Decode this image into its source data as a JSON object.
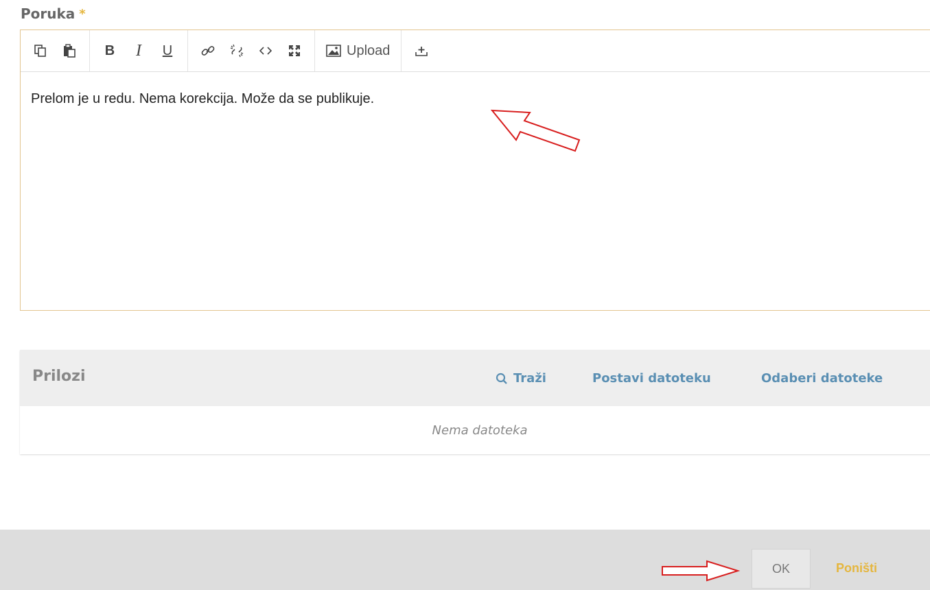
{
  "form": {
    "label": "Poruka",
    "required_mark": "*"
  },
  "toolbar": {
    "groups": [
      [
        "copy-icon",
        "paste-icon"
      ],
      [
        "bold-icon",
        "italic-icon",
        "underline-icon"
      ],
      [
        "link-icon",
        "unlink-icon",
        "code-icon",
        "fullscreen-icon"
      ],
      [
        "image-icon"
      ],
      [
        "insert-icon"
      ]
    ],
    "bold_label": "B",
    "italic_label": "I",
    "underline_label": "U",
    "upload_label": "Upload"
  },
  "editor": {
    "content": "Prelom je u redu. Nema korekcija. Može da se publikuje."
  },
  "attachments": {
    "title": "Prilozi",
    "search_label": "Traži",
    "upload_label": "Postavi datoteku",
    "select_label": "Odaberi datoteke",
    "empty_text": "Nema datoteka"
  },
  "footer": {
    "ok_label": "OK",
    "cancel_label": "Poništi"
  },
  "colors": {
    "accent": "#e5b63e",
    "link": "#5a8fb3",
    "annotation_arrow": "#d81e1e"
  }
}
